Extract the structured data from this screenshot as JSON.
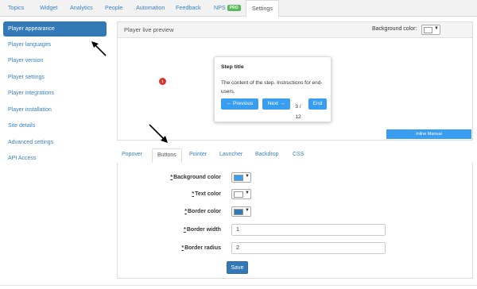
{
  "nav": {
    "tabs": [
      {
        "label": "Topics"
      },
      {
        "label": "Widget"
      },
      {
        "label": "Analytics"
      },
      {
        "label": "People"
      },
      {
        "label": "Automation"
      },
      {
        "label": "Feedback"
      },
      {
        "label": "NPS",
        "badge": "PRO"
      },
      {
        "label": "Settings",
        "active": true
      }
    ]
  },
  "sidebar": {
    "items": [
      {
        "label": "Player appearance",
        "active": true
      },
      {
        "label": "Player languages"
      },
      {
        "label": "Player version"
      },
      {
        "label": "Player settings"
      },
      {
        "label": "Player integrations"
      },
      {
        "label": "Player installation"
      },
      {
        "label": "Site details"
      },
      {
        "label": "Advanced settings"
      },
      {
        "label": "API Access"
      }
    ]
  },
  "preview": {
    "title": "Player live preview",
    "background_color_label": "Background color:",
    "background_color_value": "#ffffff",
    "hotspot_label": "1",
    "step": {
      "title": "Step title",
      "body": "The content of the step. Instructions for end-users.",
      "prev_label": "← Previous",
      "next_label": "Next →",
      "counter": "3 / 12",
      "end_label": "End"
    },
    "brand_bar": "Inline Manual"
  },
  "subtabs": [
    {
      "label": "Popover"
    },
    {
      "label": "Buttons",
      "active": true
    },
    {
      "label": "Pointer"
    },
    {
      "label": "Launcher"
    },
    {
      "label": "Backdrop"
    },
    {
      "label": "CSS"
    }
  ],
  "form": {
    "fields": [
      {
        "label": "Background color",
        "type": "color",
        "value": "#3a9ef0"
      },
      {
        "label": "Text color",
        "type": "color",
        "value": "#ffffff"
      },
      {
        "label": "Border color",
        "type": "color",
        "value": "#3379b7"
      },
      {
        "label": "Border width",
        "type": "text",
        "value": "1"
      },
      {
        "label": "Border radius",
        "type": "text",
        "value": "2"
      }
    ],
    "required_mark": "*",
    "save_label": "Save"
  },
  "colors": {
    "accent": "#3379b7",
    "button_blue": "#3a9ef0",
    "link": "#3a82c4",
    "hotspot": "#d9362b",
    "badge_green": "#5cb85c"
  }
}
